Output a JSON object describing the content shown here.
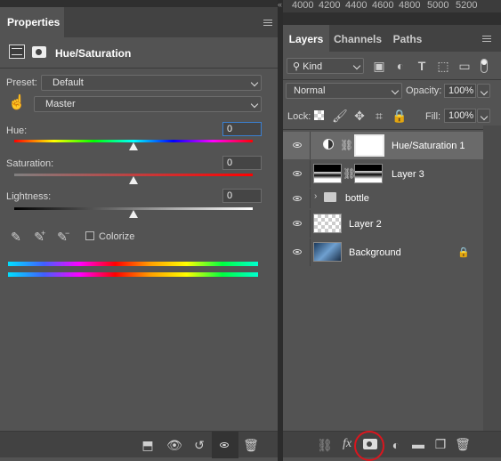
{
  "properties": {
    "tab_label": "Properties",
    "adjustment_title": "Hue/Saturation",
    "preset_label": "Preset:",
    "preset_value": "Default",
    "channel_value": "Master",
    "hue_label": "Hue:",
    "hue_value": "0",
    "hue_slider_position": 0.5,
    "saturation_label": "Saturation:",
    "saturation_value": "0",
    "saturation_slider_position": 0.5,
    "lightness_label": "Lightness:",
    "lightness_value": "0",
    "lightness_slider_position": 0.5,
    "colorize_label": "Colorize",
    "colorize_checked": false
  },
  "ruler": {
    "marks": [
      "4000",
      "4200",
      "4400",
      "4600",
      "4800",
      "5000",
      "5200"
    ]
  },
  "layers_panel": {
    "tabs": [
      "Layers",
      "Channels",
      "Paths"
    ],
    "active_tab": "Layers",
    "filter_kind": "Kind",
    "blend_mode": "Normal",
    "opacity_label": "Opacity:",
    "opacity_value": "100%",
    "lock_label": "Lock:",
    "fill_label": "Fill:",
    "fill_value": "100%",
    "layers": [
      {
        "name": "Hue/Saturation 1",
        "type": "adjustment",
        "selected": true
      },
      {
        "name": "Layer 3",
        "type": "masked",
        "selected": false
      },
      {
        "name": "bottle",
        "type": "group",
        "selected": false
      },
      {
        "name": "Layer 2",
        "type": "pixel",
        "selected": false
      },
      {
        "name": "Background",
        "type": "background",
        "locked": true,
        "selected": false
      }
    ]
  },
  "colors": {
    "panel_bg": "#535353",
    "tabbar_bg": "#424242",
    "selected_row": "#6a6a6a",
    "highlight_circle": "#d9161e"
  },
  "icons": {
    "add_mask": "add-layer-mask-icon",
    "fx": "fx-icon",
    "link": "link-icon"
  }
}
